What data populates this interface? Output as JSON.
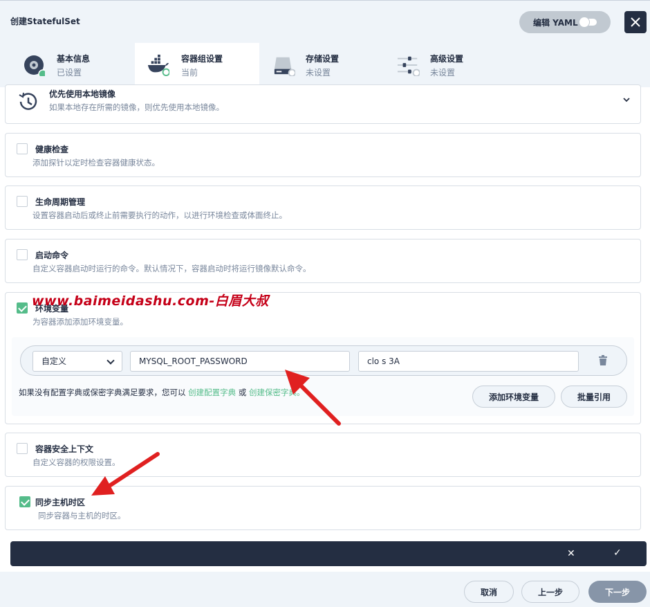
{
  "header": {
    "title": "创建StatefulSet",
    "yaml_label": "编辑 YAML"
  },
  "tabs": [
    {
      "name": "基本信息",
      "status": "已设置",
      "icon": "disk-icon"
    },
    {
      "name": "容器组设置",
      "status": "当前",
      "icon": "docker-icon"
    },
    {
      "name": "存储设置",
      "status": "未设置",
      "icon": "storage-icon"
    },
    {
      "name": "高级设置",
      "status": "未设置",
      "icon": "sliders-icon"
    }
  ],
  "sections": {
    "local_image": {
      "title": "优先使用本地镜像",
      "desc": "如果本地存在所需的镜像，则优先使用本地镜像。"
    },
    "health_check": {
      "title": "健康检查",
      "desc": "添加探针以定时检查容器健康状态。"
    },
    "lifecycle": {
      "title": "生命周期管理",
      "desc": "设置容器启动后或终止前需要执行的动作，以进行环境检查或体面终止。"
    },
    "start_cmd": {
      "title": "启动命令",
      "desc": "自定义容器启动时运行的命令。默认情况下，容器启动时将运行镜像默认命令。"
    },
    "env": {
      "title": "环境变量",
      "desc": "为容器添加添加环境变量。",
      "type_value": "自定义",
      "key_value": "MYSQL_ROOT_PASSWORD",
      "val_value": "clo    s    3A",
      "note_prefix": "如果没有配置字典或保密字典满足要求，您可以",
      "link_configmap": "创建配置字典",
      "note_or": "或",
      "link_secret": "创建保密字典。",
      "add_label": "添加环境变量",
      "batch_label": "批量引用"
    },
    "security": {
      "title": "容器安全上下文",
      "desc": "自定义容器的权限设置。"
    },
    "timezone": {
      "title": "同步主机时区",
      "desc": "同步容器与主机的时区。"
    }
  },
  "watermark": "www.baimeidashu.com-白眉大叔",
  "footer": {
    "cancel": "取消",
    "prev": "上一步",
    "next": "下一步"
  },
  "colors": {
    "accent": "#55bc8a",
    "dark": "#242e42",
    "arrow": "#e02020"
  }
}
